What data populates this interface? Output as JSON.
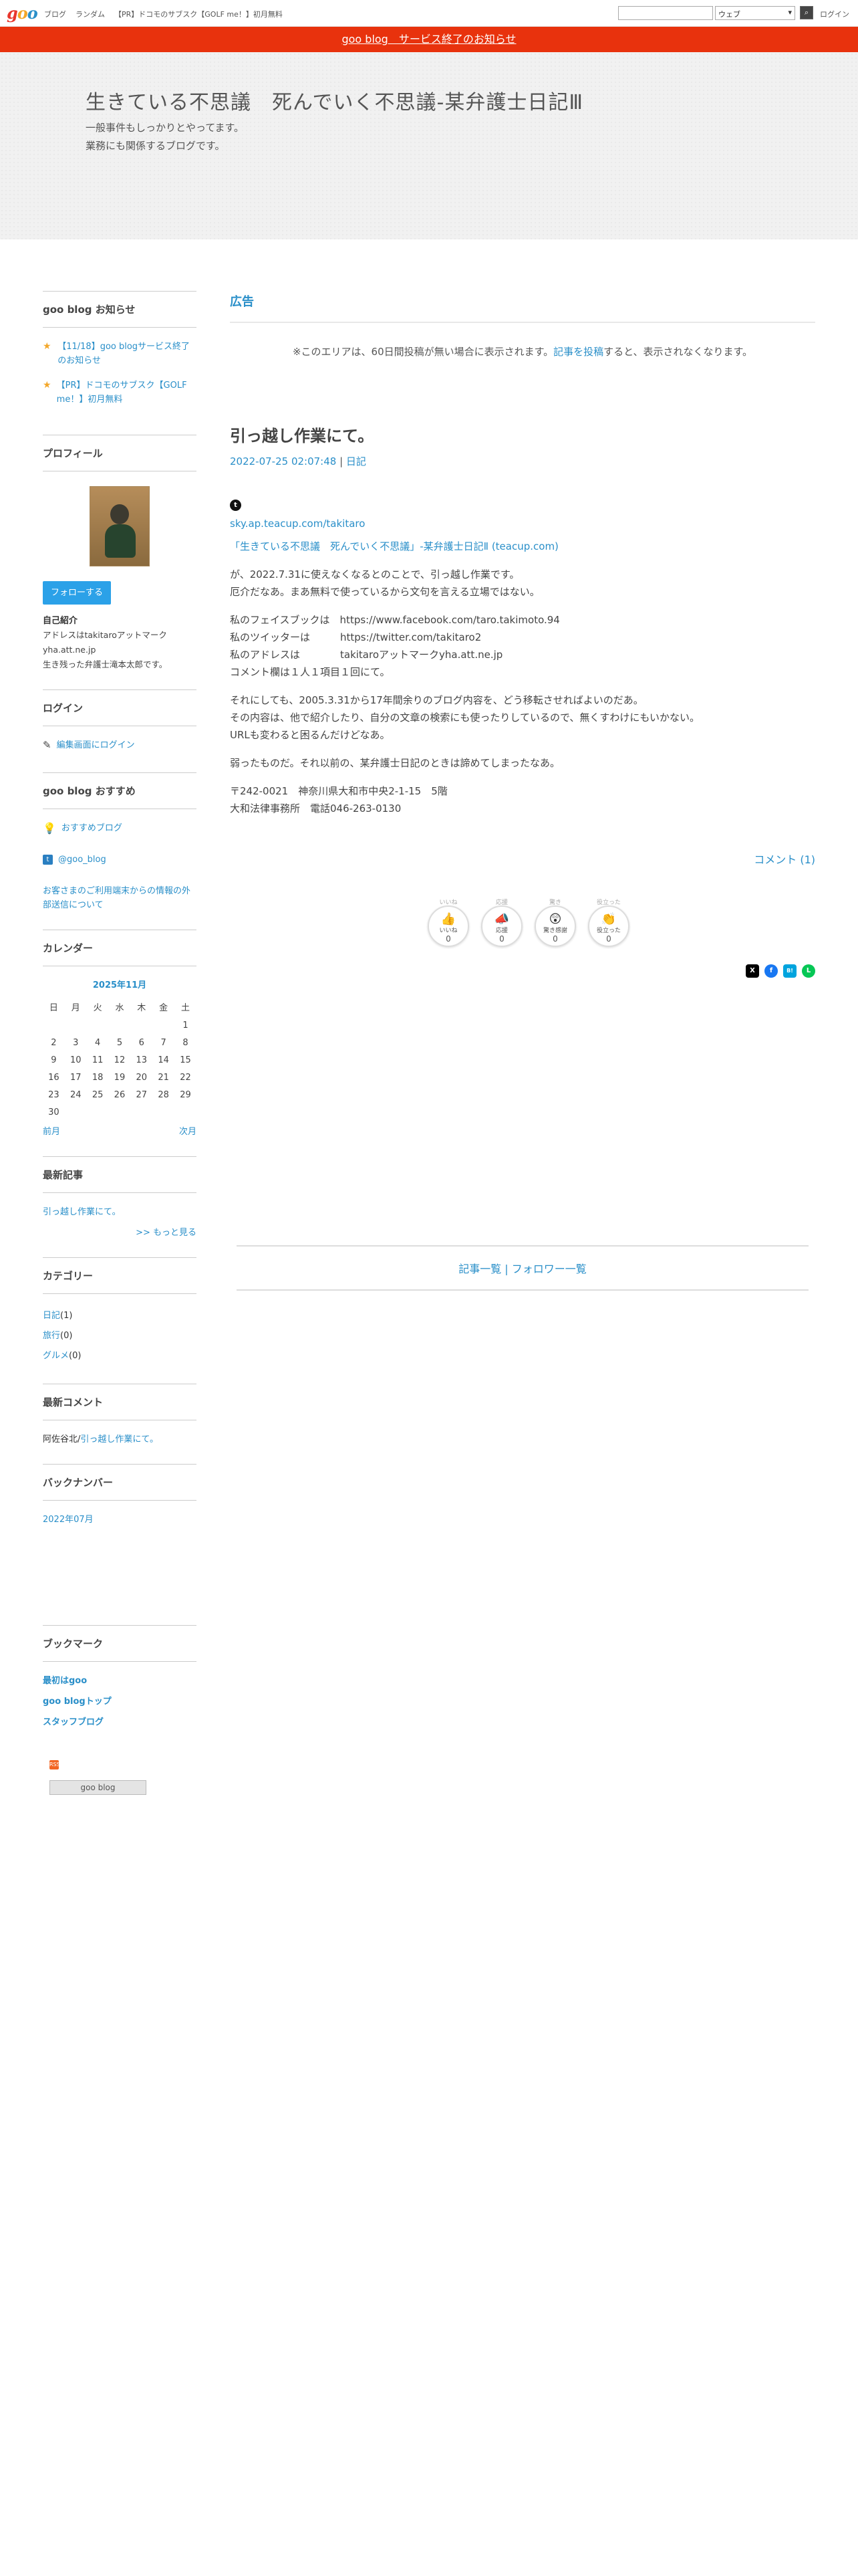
{
  "topbar": {
    "logo": [
      "g",
      "o",
      "o"
    ],
    "nav": [
      "ブログ",
      "ランダム",
      "【PR】ドコモのサブスク【GOLF me！】初月無料"
    ],
    "search_select": "ウェブ",
    "login": "ログイン"
  },
  "notice": "goo blog　サービス終了のお知らせ",
  "header": {
    "title": "生きている不思議　死んでいく不思議-某弁護士日記Ⅲ",
    "description": "一般事件もしっかりとやってます。\n業務にも関係するブログです。"
  },
  "sidebar": {
    "notice_title": "goo blog お知らせ",
    "notice_items": [
      "【11/18】goo blogサービス終了のお知らせ",
      "【PR】ドコモのサブスク【GOLF me！】初月無料"
    ],
    "profile_title": "プロフィール",
    "follow": "フォローする",
    "profile_label": "自己紹介",
    "profile_text": "アドレスはtakitaroアットマークyha.att.ne.jp\n生き残った弁護士滝本太郎です。",
    "login_title": "ログイン",
    "login_link": "編集画面にログイン",
    "recommend_title": "goo blog おすすめ",
    "recommend_items": [
      "おすすめブログ",
      "@goo_blog",
      "お客さまのご利用端末からの情報の外部送信について"
    ],
    "calendar_title": "カレンダー",
    "calendar": {
      "month": "2025年11月",
      "weekdays": [
        "日",
        "月",
        "火",
        "水",
        "木",
        "金",
        "土"
      ],
      "weeks": [
        [
          "",
          "",
          "",
          "",
          "",
          "",
          "1"
        ],
        [
          "2",
          "3",
          "4",
          "5",
          "6",
          "7",
          "8"
        ],
        [
          "9",
          "10",
          "11",
          "12",
          "13",
          "14",
          "15"
        ],
        [
          "16",
          "17",
          "18",
          "19",
          "20",
          "21",
          "22"
        ],
        [
          "23",
          "24",
          "25",
          "26",
          "27",
          "28",
          "29"
        ],
        [
          "30",
          "",
          "",
          "",
          "",
          "",
          ""
        ]
      ],
      "prev": "前月",
      "next": "次月"
    },
    "recent_title": "最新記事",
    "recent_item": "引っ越し作業にて。",
    "recent_more": ">> もっと見る",
    "category_title": "カテゴリー",
    "categories": [
      {
        "name": "日記",
        "count": "(1)"
      },
      {
        "name": "旅行",
        "count": "(0)"
      },
      {
        "name": "グルメ",
        "count": "(0)"
      }
    ],
    "comment_title": "最新コメント",
    "comment_author": "阿佐谷北/",
    "comment_link": "引っ越し作業にて。",
    "backnumber_title": "バックナンバー",
    "backnumber_item": "2022年07月",
    "bookmark_title": "ブックマーク",
    "bookmarks": [
      "最初はgoo",
      "goo blogトップ",
      "スタッフブログ"
    ],
    "rss": "RSS",
    "badge": "goo blog"
  },
  "main": {
    "ad_title": "広告",
    "ad_note_pre": "※このエリアは、60日間投稿が無い場合に表示されます。",
    "ad_note_link": "記事を投稿",
    "ad_note_post": "すると、表示されなくなります。",
    "entry_title": "引っ越し作業にて。",
    "entry_date": "2022-07-25 02:07:48",
    "entry_sep": " | ",
    "entry_category": "日記",
    "ext_icon": "t",
    "link1": "sky.ap.teacup.com/takitaro",
    "link2": "「生きている不思議　死んでいく不思議」-某弁護士日記Ⅱ (teacup.com)",
    "p1": "が、2022.7.31に使えなくなるとのことで、引っ越し作業です。\n厄介だなあ。まあ無料で使っているから文句を言える立場ではない。",
    "p2": "私のフェイスブックは　https://www.facebook.com/taro.takimoto.94\n私のツイッターは　　　https://twitter.com/takitaro2\n私のアドレスは　　　　takitaroアットマークyha.att.ne.jp\nコメント欄は１人１項目１回にて。",
    "p3": "それにしても、2005.3.31から17年間余りのブログ内容を、どう移転させればよいのだあ。\nその内容は、他で紹介したり、自分の文章の検索にも使ったりしているので、無くすわけにもいかない。\nURLも変わると困るんだけどなあ。",
    "p4": "弱ったものだ。それ以前の、某弁護士日記のときは諦めてしまったなあ。",
    "p5": "〒242-0021　神奈川県大和市中央2-1-15　5階\n大和法律事務所　電話046-263-0130",
    "comment_link": "コメント (1)",
    "reactions": [
      {
        "cap": "いいね",
        "emo": "👍",
        "label": "いいね",
        "count": "0"
      },
      {
        "cap": "応援",
        "emo": "📣",
        "label": "応援",
        "count": "0"
      },
      {
        "cap": "驚き",
        "emo": "😲",
        "label": "驚き感謝",
        "count": "0"
      },
      {
        "cap": "役立った",
        "emo": "👏",
        "label": "役立った",
        "count": "0"
      }
    ],
    "shares": [
      {
        "name": "x-share-icon",
        "glyph": "X",
        "color": "#000000"
      },
      {
        "name": "facebook-share-icon",
        "glyph": "f",
        "color": "#1877f2"
      },
      {
        "name": "hatena-share-icon",
        "glyph": "B!",
        "color": "#00a4de"
      },
      {
        "name": "line-share-icon",
        "glyph": "L",
        "color": "#06c755"
      }
    ],
    "entry_list": "記事一覧",
    "list_sep": " | ",
    "follower_list": "フォロワー一覧"
  }
}
